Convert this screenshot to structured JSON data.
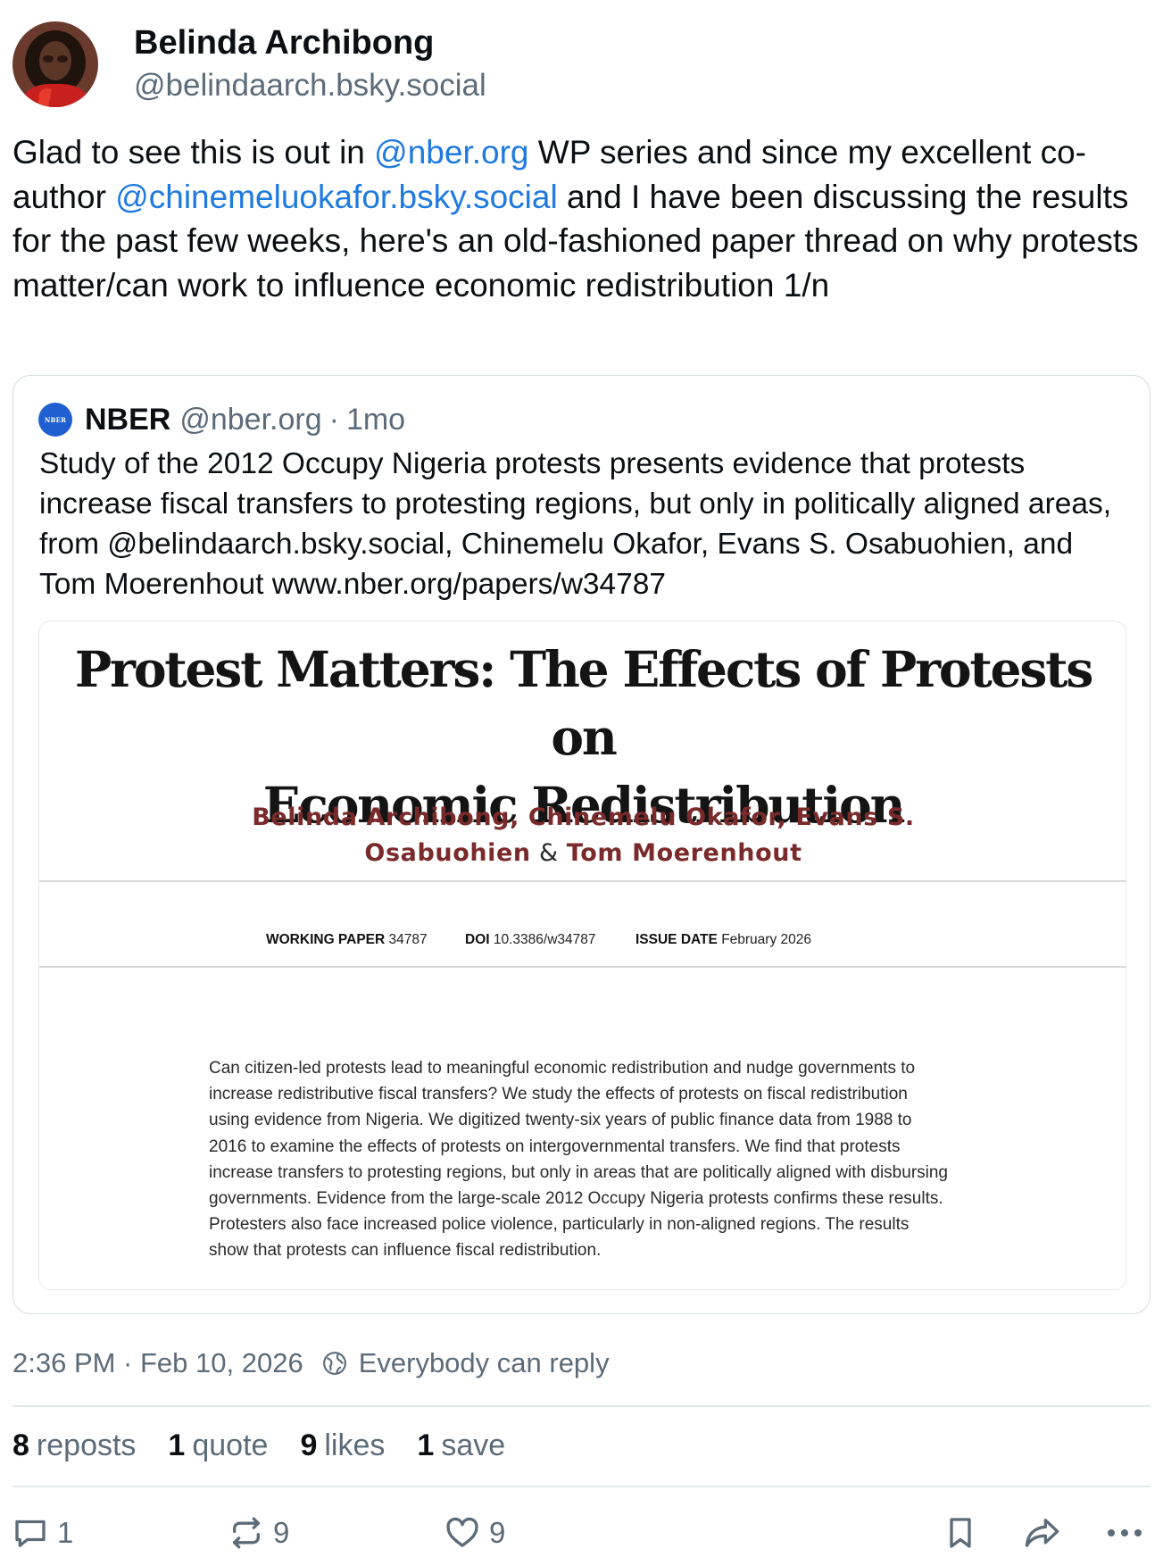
{
  "author": {
    "name": "Belinda Archibong",
    "handle": "@belindaarch.bsky.social"
  },
  "post": {
    "text_1": "Glad to see this is out in ",
    "mention_1": "@nber.org",
    "text_2": " WP series and since my excellent co-author ",
    "mention_2": "@chinemeluokafor.bsky.social",
    "text_3": " and I have been discussing the results for the past few weeks, here's an old-fashioned paper thread on why protests matter/can work to influence economic redistribution 1/n"
  },
  "quote": {
    "logo_text": "NBER",
    "name": "NBER",
    "handle": "@nber.org",
    "separator": "·",
    "time": "1mo",
    "text": "Study of the 2012 Occupy Nigeria protests presents evidence that protests increase fiscal transfers to protesting regions, but only in politically aligned areas, from @belindaarch.bsky.social, Chinemelu Okafor, Evans S. Osabuohien, and Tom Moerenhout www.nber.org/papers/w34787",
    "paper": {
      "title_line1": "Protest Matters: The Effects of Protests on",
      "title_line2": "Economic Redistribution",
      "authors_line1_a": "Belinda Archibong",
      "authors_line1_b": ", Chinemelu Okafor",
      "authors_line1_c": ", Evans S.",
      "authors_line2_a": "Osabuohien",
      "authors_line2_amp": " & ",
      "authors_line2_b": "Tom Moerenhout",
      "wp_label": "WORKING PAPER",
      "wp_value": "34787",
      "doi_label": "DOI",
      "doi_value": "10.3386/w34787",
      "issue_label": "ISSUE DATE",
      "issue_value": "February 2026",
      "abstract": [
        "Can citizen-led protests lead to meaningful economic redistribution and nudge governments to",
        "increase redistributive fiscal transfers? We study the effects of protests on fiscal redistribution",
        "using evidence from Nigeria. We digitized twenty-six years of public finance data from 1988 to",
        "2016 to examine the effects of protests on intergovernmental transfers. We find that protests",
        "increase transfers to protesting regions, but only in areas that are politically aligned with disbursing",
        "governments. Evidence from the large-scale 2012 Occupy Nigeria protests confirms these results.",
        "Protesters also face increased police violence, particularly in non-aligned regions. The results",
        "show that protests can influence fiscal redistribution."
      ]
    }
  },
  "meta": {
    "timestamp": "2:36 PM · Feb 10, 2026",
    "reply_setting": "Everybody can reply"
  },
  "stats": {
    "reposts_count": "8",
    "reposts_label": "reposts",
    "quotes_count": "1",
    "quotes_label": "quote",
    "likes_count": "9",
    "likes_label": "likes",
    "saves_count": "1",
    "saves_label": "save"
  },
  "actions": {
    "reply_count": "1",
    "repost_count": "9",
    "like_count": "9"
  },
  "colors": {
    "mention": "#1f7ae0",
    "muted": "#5c6b7a",
    "nber_blue": "#1f5fd1",
    "author_red": "#7a2a2a"
  }
}
